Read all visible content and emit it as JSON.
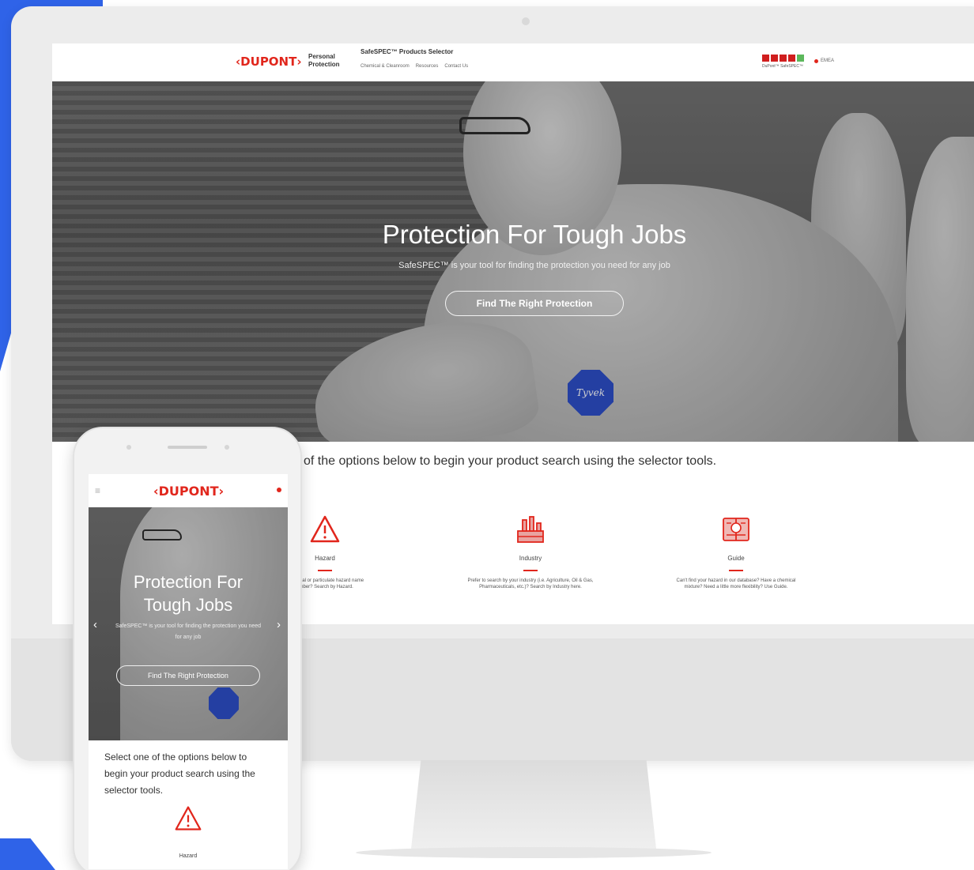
{
  "site": {
    "logo": "‹DUPONT›",
    "brand_sub_1": "Personal",
    "brand_sub_2": "Protection",
    "product_title": "SafeSPEC™ Products Selector",
    "nav": [
      "Chemical & Cleanroom",
      "Resources",
      "Contact Us"
    ],
    "flag_caption": "DuPont™ SafeSPEC™",
    "language": "EMEA"
  },
  "hero": {
    "title": "Protection For Tough Jobs",
    "subtitle": "SafeSPEC™ is your tool for finding the protection you need for any job",
    "cta": "Find The Right Protection",
    "badge_text": "Tyvek"
  },
  "intro": "of the options below to begin your product search using the selector tools.",
  "options": [
    {
      "label": "Hazard",
      "icon": "warning-triangle-icon",
      "desc_1": "biological or particulate hazard name",
      "desc_2": "umber? Search by Hazard."
    },
    {
      "label": "Industry",
      "icon": "factory-icon",
      "desc_1": "Prefer to search by your industry (i.e. Agriculture, Oil & Gas,",
      "desc_2": "Pharmaceuticals, etc.)? Search by Industry here."
    },
    {
      "label": "Guide",
      "icon": "guide-book-icon",
      "desc_1": "Can't find your hazard in our database? Have a chemical",
      "desc_2": "mixture? Need a little more flexibility? Use Guide."
    }
  ],
  "phone": {
    "menu": "≡",
    "logo": "‹DUPONT›",
    "title_1": "Protection For",
    "title_2": "Tough Jobs",
    "subtitle": "SafeSPEC™ is your tool for finding the protection you need for any job",
    "cta": "Find The Right Protection",
    "arrow_left": "‹",
    "arrow_right": "›",
    "intro": "Select one of the options below to begin your product search using the selector tools.",
    "hazard_label": "Hazard"
  },
  "colors": {
    "brand_red": "#e1261c",
    "accent_blue": "#2f63e8",
    "tyvek_blue": "#2346c4"
  }
}
